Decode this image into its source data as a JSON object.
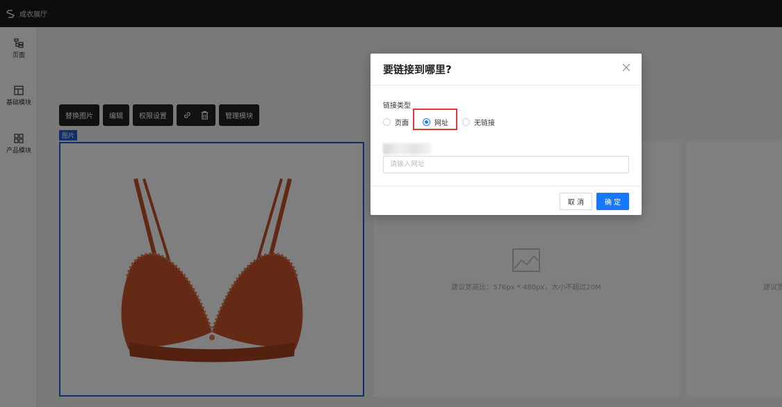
{
  "app": {
    "brand": "成衣展厅"
  },
  "sidebar": {
    "items": [
      {
        "label": "页面",
        "icon": "page-tree-icon"
      },
      {
        "label": "基础模块",
        "icon": "layout-icon"
      },
      {
        "label": "产品模块",
        "icon": "grid-icon"
      }
    ]
  },
  "toolbar": {
    "replace_image": "替换图片",
    "edit": "编辑",
    "permission": "权限设置",
    "manage_module": "管理模块"
  },
  "canvas": {
    "image_tag": "图片",
    "placeholder_hint": "建议宽高比：576px * 480px，大小不超过20M",
    "placeholder_hint_partial": "建议宽"
  },
  "dialog": {
    "title": "要链接到哪里?",
    "link_type_label": "链接类型",
    "options": [
      "页面",
      "网址",
      "无链接"
    ],
    "selected": "网址",
    "url_placeholder": "请输入网址",
    "cancel": "取 消",
    "confirm": "确 定"
  },
  "colors": {
    "accent": "#1677ff",
    "highlight": "#e53935",
    "selection": "#1e5ed8",
    "topbar": "#1b1b1b"
  }
}
